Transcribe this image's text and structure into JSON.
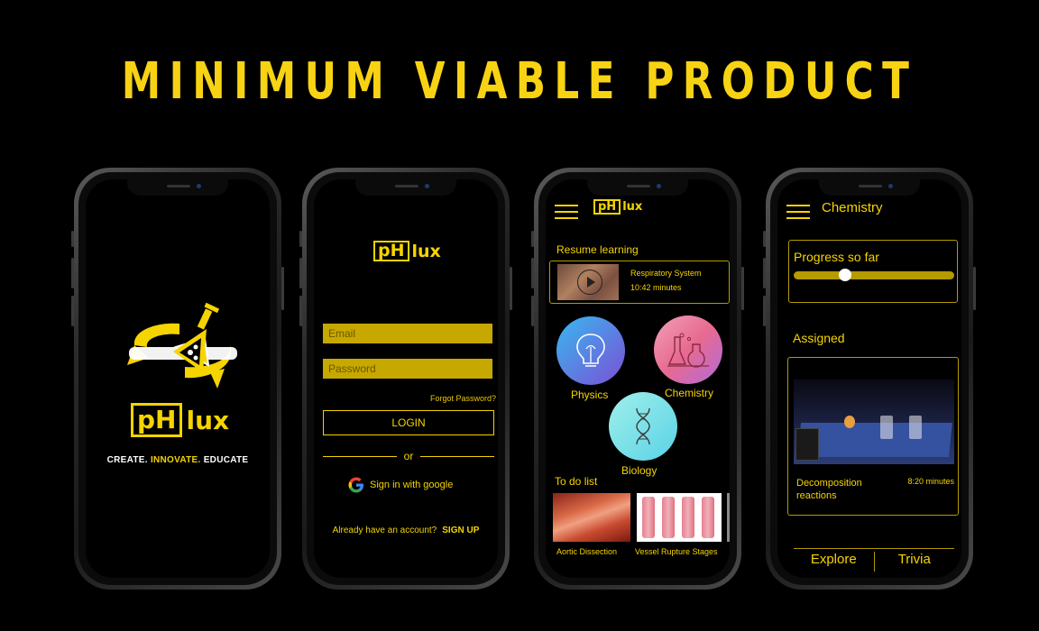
{
  "heading": "MINIMUM VIABLE PRODUCT",
  "brand": {
    "left": "pH",
    "right": "lux",
    "accent": "#f5d400"
  },
  "splash": {
    "tagline_1": "CREATE.",
    "tagline_2": "INNOVATE.",
    "tagline_3": "EDUCATE",
    "icon": "flask-rotate-icon"
  },
  "login": {
    "email_placeholder": "Email",
    "password_placeholder": "Password",
    "forgot": "Forgot Password?",
    "login_button": "LOGIN",
    "or": "or",
    "google": "Sign in with google",
    "account_text": "Already have an account?",
    "signup": "SIGN UP"
  },
  "home": {
    "resume_title": "Resume learning",
    "resume_item": {
      "title": "Respiratory System",
      "duration": "10:42 minutes"
    },
    "subjects": [
      {
        "label": "Physics",
        "icon": "lightbulb-icon"
      },
      {
        "label": "Chemistry",
        "icon": "flasks-icon"
      },
      {
        "label": "Biology",
        "icon": "dna-icon"
      }
    ],
    "todo_title": "To do list",
    "todo": [
      {
        "label": "Aortic Dissection"
      },
      {
        "label": "Vessel Rupture Stages"
      }
    ]
  },
  "chemistry": {
    "title": "Chemistry",
    "progress_label": "Progress so far",
    "progress": 0.32,
    "assigned_title": "Assigned",
    "assigned_item": {
      "title_1": "Decomposition",
      "title_2": "reactions",
      "duration": "8:20 minutes"
    },
    "tabs": [
      "Explore",
      "Trivia"
    ]
  }
}
